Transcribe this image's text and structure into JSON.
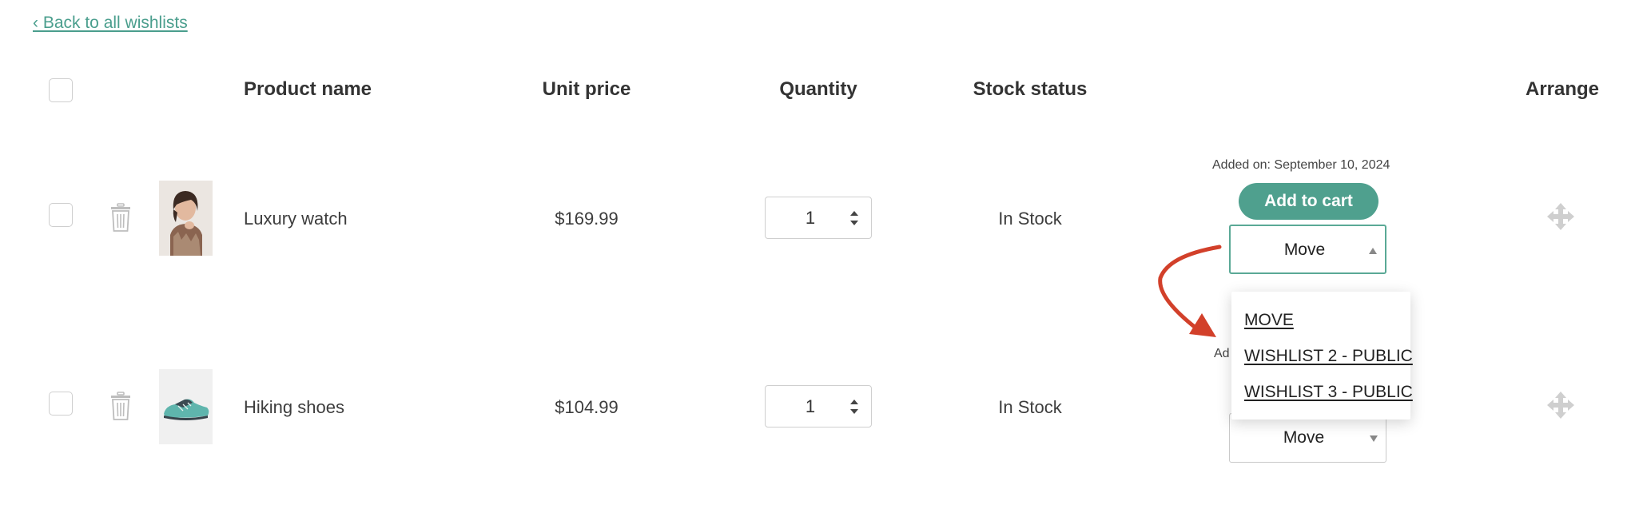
{
  "nav": {
    "back_link": "‹ Back to all wishlists"
  },
  "table": {
    "headers": {
      "product_name": "Product name",
      "unit_price": "Unit price",
      "quantity": "Quantity",
      "stock_status": "Stock status",
      "arrange": "Arrange"
    },
    "rows": [
      {
        "name": "Luxury watch",
        "price": "$169.99",
        "quantity": "1",
        "stock": "In Stock",
        "added_on": "Added on: September 10, 2024",
        "add_to_cart": "Add to cart",
        "move_label": "Move",
        "thumb_icon": "portrait-photo"
      },
      {
        "name": "Hiking shoes",
        "price": "$104.99",
        "quantity": "1",
        "stock": "In Stock",
        "added_on_partial": "Ad",
        "move_label": "Move",
        "thumb_icon": "shoe-photo"
      }
    ]
  },
  "move_dropdown": {
    "options": [
      "MOVE",
      "WISHLIST 2 - PUBLIC",
      "WISHLIST 3 - PUBLIC"
    ]
  },
  "colors": {
    "accent": "#4fa08e",
    "annotation_arrow": "#d2402a"
  }
}
